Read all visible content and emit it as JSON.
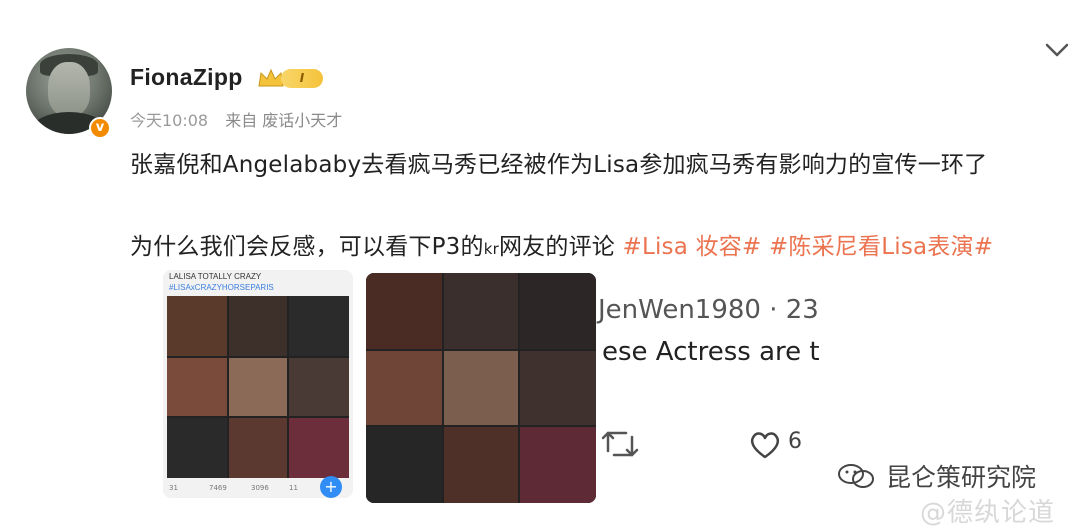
{
  "post": {
    "username": "FionaZipp",
    "vip_level": "I",
    "time": "今天10:08",
    "source": "来自 废话小天才",
    "text_line1": "张嘉倪和Angelababy去看疯马秀已经被作为Lisa参加疯马秀有影响力的宣传一环了",
    "text_line2_plain": "为什么我们会反感，可以看下P3的",
    "text_line2_kr": "kr",
    "text_line2_rest": "网友的评论 ",
    "tag1": "#Lisa 妆容#",
    "tag2": "#陈采尼看Lisa表演#"
  },
  "images": {
    "img1_caption_title": "LALISA TOTALLY CRAZY",
    "img1_caption_tag": "#LISAxCRAZYHORSEPARIS",
    "img1_actions": [
      "31",
      "7469",
      "3096",
      "11",
      "+"
    ],
    "img3_user": "JenWen1980 · 23",
    "img3_text": "ese Actress are t",
    "img3_like_count": "6"
  },
  "watermarks": {
    "line1": "昆仑策研究院",
    "line2": "@德纨论道"
  },
  "colors": {
    "tag": "#eb7350",
    "meta": "#9a9a9a",
    "vip": "#f5c33b",
    "badge": "#f28b00"
  }
}
